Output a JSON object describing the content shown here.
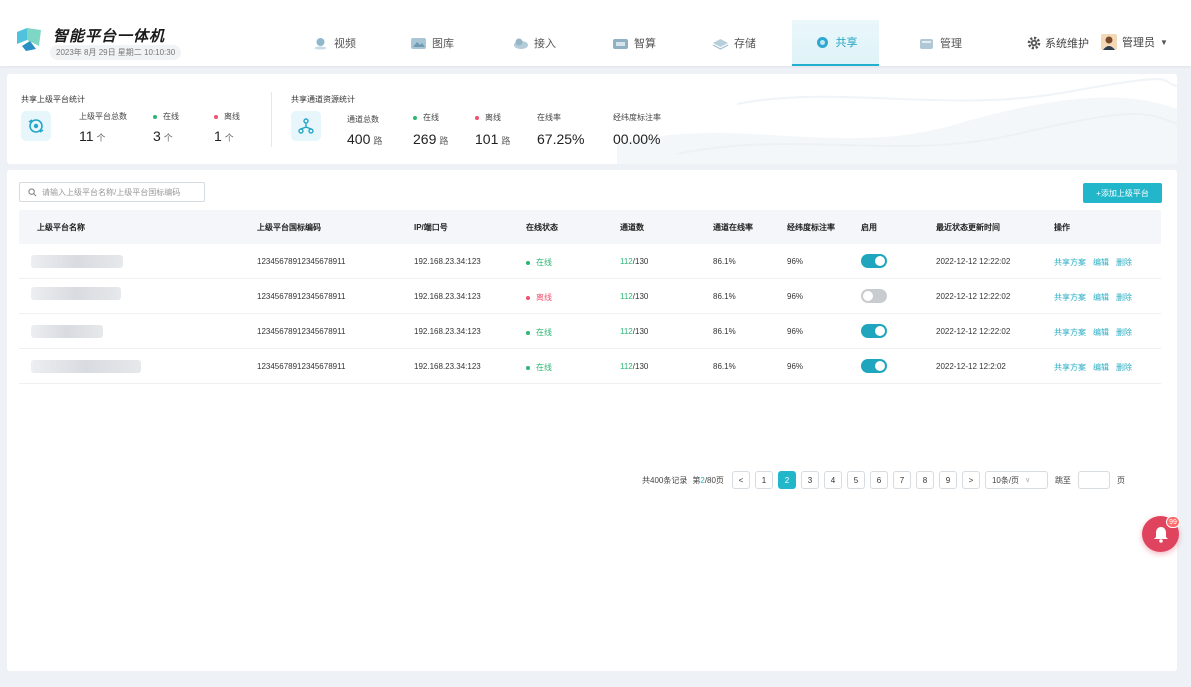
{
  "header": {
    "app_title": "智能平台一体机",
    "datetime": "2023年 8月 29日  星期二  10:10:30",
    "nav": [
      {
        "label": "视频",
        "icon": "map-pin-icon"
      },
      {
        "label": "图库",
        "icon": "gallery-icon"
      },
      {
        "label": "接入",
        "icon": "cloud-icon"
      },
      {
        "label": "智算",
        "icon": "compute-icon"
      },
      {
        "label": "存储",
        "icon": "storage-icon"
      },
      {
        "label": "共享",
        "icon": "share-icon",
        "active": true
      },
      {
        "label": "管理",
        "icon": "manage-icon"
      }
    ],
    "system_label": "系统维护",
    "user_label": "管理员"
  },
  "stats": {
    "platform": {
      "title": "共享上级平台统计",
      "total_label": "上级平台总数",
      "total_value": "11",
      "total_unit": "个",
      "online_label": "在线",
      "online_value": "3",
      "online_unit": "个",
      "offline_label": "离线",
      "offline_value": "1",
      "offline_unit": "个"
    },
    "channel": {
      "title": "共享通道资源统计",
      "total_label": "通道总数",
      "total_value": "400",
      "total_unit": "路",
      "online_label": "在线",
      "online_value": "269",
      "online_unit": "路",
      "offline_label": "离线",
      "offline_value": "101",
      "offline_unit": "路",
      "rate_label": "在线率",
      "rate_value": "67.25%",
      "geo_label": "经纬度标注率",
      "geo_value": "00.00%"
    }
  },
  "toolbar": {
    "search_placeholder": "请输入上级平台名称/上级平台国标编码",
    "add_button": "+添加上级平台"
  },
  "table": {
    "columns": [
      "上级平台名称",
      "上级平台国标编码",
      "IP/端口号",
      "在线状态",
      "通道数",
      "通道在线率",
      "经纬度标注率",
      "启用",
      "最近状态更新时间",
      "操作"
    ],
    "rows": [
      {
        "code": "12345678912345678911",
        "ip": "192.168.23.34:123",
        "status": "在线",
        "online": true,
        "ch_online": "112",
        "ch_total": "/130",
        "rate": "86.1%",
        "geo": "96%",
        "enabled": true,
        "updated": "2022-12-12 12:22:02"
      },
      {
        "code": "12345678912345678911",
        "ip": "192.168.23.34:123",
        "status": "离线",
        "online": false,
        "ch_online": "112",
        "ch_total": "/130",
        "rate": "86.1%",
        "geo": "96%",
        "enabled": false,
        "updated": "2022-12-12 12:22:02"
      },
      {
        "code": "12345678912345678911",
        "ip": "192.168.23.34:123",
        "status": "在线",
        "online": true,
        "ch_online": "112",
        "ch_total": "/130",
        "rate": "86.1%",
        "geo": "96%",
        "enabled": true,
        "updated": "2022-12-12 12:22:02"
      },
      {
        "code": "12345678912345678911",
        "ip": "192.168.23.34:123",
        "status": "在线",
        "online": true,
        "ch_online": "112",
        "ch_total": "/130",
        "rate": "86.1%",
        "geo": "96%",
        "enabled": true,
        "updated": "2022-12-12 12:2:02"
      }
    ],
    "actions": [
      "共享方案",
      "编辑",
      "删除"
    ]
  },
  "pagination": {
    "total_text": "共400条记录",
    "page_prefix": "第",
    "page_current": "2",
    "page_suffix": "/80页",
    "prev": "<",
    "pages": [
      "1",
      "2",
      "3",
      "4",
      "5",
      "6",
      "7",
      "8",
      "9"
    ],
    "next": ">",
    "size_label": "10条/页",
    "goto_label": "跳至",
    "page_unit": "页"
  },
  "notifications": {
    "count": "99"
  },
  "colors": {
    "accent": "#22b6cb",
    "online": "#2bb673",
    "offline": "#f0506e",
    "link": "#2aaec4",
    "toggle_on": "#1fa6be",
    "toggle_off": "#c8cbd0"
  }
}
